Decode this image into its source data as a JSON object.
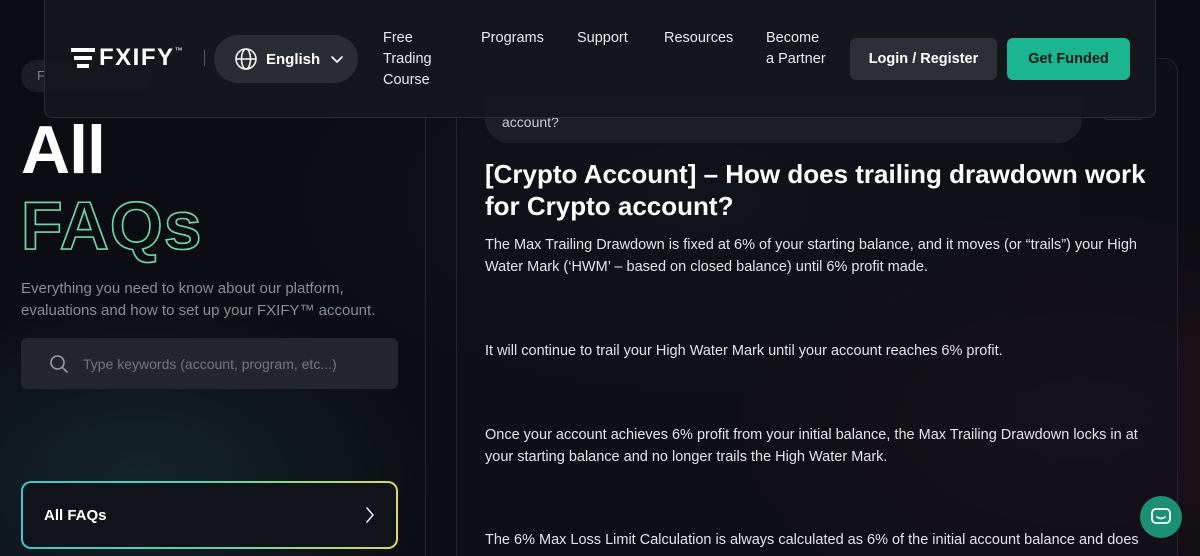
{
  "header": {
    "logo_text": "FXIFY",
    "logo_tm": "™",
    "language": "English",
    "nav": {
      "free_trading_course_line1": "Free",
      "free_trading_course_line2": "Trading",
      "free_trading_course_line3": "Course",
      "programs": "Programs",
      "support": "Support",
      "resources": "Resources",
      "partner_line1": "Become",
      "partner_line2": "a Partner"
    },
    "login_label": "Login / Register",
    "funded_label": "Get Funded"
  },
  "sidebar": {
    "breadcrumb": "F",
    "title_line1": "All",
    "title_line2": "FAQs",
    "subtitle": "Everything you need to know about our platform, evaluations and how to set up your FXIFY™ account.",
    "search_placeholder": "Type keywords (account, program, etc...)",
    "category_label": "All FAQs"
  },
  "article": {
    "result_snippet": "account?",
    "title": "[Crypto Account] – How does trailing drawdown work for Crypto account?",
    "paragraphs": [
      "The Max Trailing Drawdown is fixed at 6% of your starting balance, and it moves (or “trails”) your High Water Mark (‘HWM’ – based on closed balance) until 6% profit made.",
      "It will continue to trail your High Water Mark until your account reaches 6% profit.",
      "Once your account achieves 6% profit from your initial balance, the Max Trailing Drawdown locks in at your starting balance and no longer trails the High Water Mark.",
      "The 6% Max Loss Limit Calculation is always calculated as 6% of the initial account balance and does"
    ]
  },
  "colors": {
    "accent": "#1bb592",
    "background": "#0c0d12"
  }
}
